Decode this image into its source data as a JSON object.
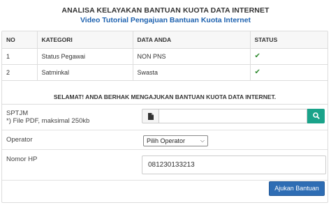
{
  "header": {
    "title": "ANALISA KELAYAKAN BANTUAN KUOTA DATA INTERNET",
    "subtitle": "Video Tutorial Pengajuan Bantuan Kuota Internet"
  },
  "table": {
    "columns": [
      "NO",
      "KATEGORI",
      "DATA ANDA",
      "STATUS"
    ],
    "rows": [
      {
        "no": "1",
        "kategori": "Status Pegawai",
        "data": "NON PNS",
        "status": "✔"
      },
      {
        "no": "2",
        "kategori": "Satminkal",
        "data": "Swasta",
        "status": "✔"
      }
    ]
  },
  "notice": "SELAMAT! ANDA BERHAK MENGAJUKAN BANTUAN KUOTA DATA INTERNET.",
  "form": {
    "sptjm_label": "SPTJM",
    "sptjm_hint": "*) File PDF, maksimal 250kb",
    "operator_label": "Operator",
    "operator_value": "Pilih Operator",
    "phone_label": "Nomor HP",
    "phone_value": "081230133213",
    "submit_label": "Ajukan Bantuan"
  },
  "icons": {
    "file": "file-icon",
    "search": "search-icon",
    "check": "check-icon",
    "dropdown": "chevron-down-icon"
  },
  "colors": {
    "link": "#1f63b0",
    "search_button": "#1aa38a",
    "submit_button": "#2e6db4",
    "check": "#2e8a2e"
  }
}
